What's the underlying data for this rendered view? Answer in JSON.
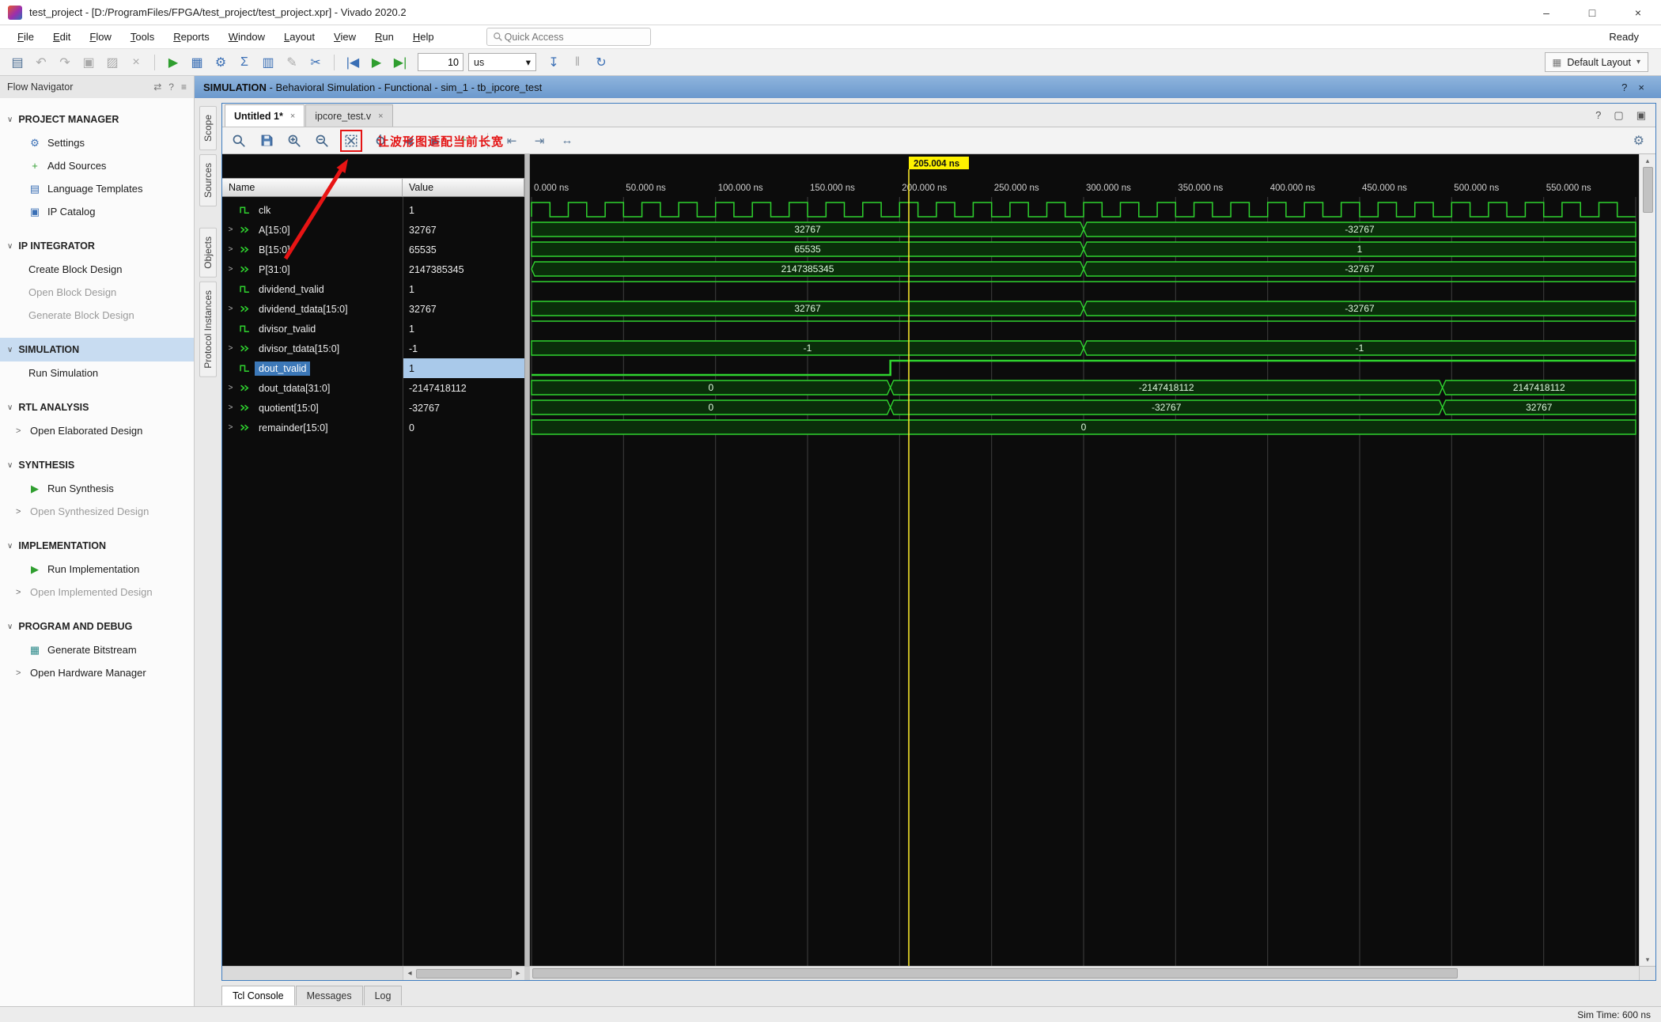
{
  "window": {
    "title": "test_project - [D:/ProgramFiles/FPGA/test_project/test_project.xpr] - Vivado 2020.2",
    "controls": [
      {
        "name": "minimize-button",
        "glyph": "–"
      },
      {
        "name": "maximize-button",
        "glyph": "□"
      },
      {
        "name": "close-button",
        "glyph": "×"
      }
    ]
  },
  "icons": {
    "dropdown": "▾",
    "help": "?",
    "close": "×",
    "chevron_down": "∨",
    "chevron_right": ">",
    "scroll_left": "◂",
    "scroll_right": "▸",
    "scroll_up": "▴",
    "scroll_down": "▾",
    "gear": "⚙"
  },
  "menu": {
    "items": [
      "File",
      "Edit",
      "Flow",
      "Tools",
      "Reports",
      "Window",
      "Layout",
      "View",
      "Run",
      "Help"
    ],
    "quick_access_placeholder": "Quick Access",
    "ready_label": "Ready"
  },
  "toolbar": {
    "items": [
      {
        "t": "icon",
        "name": "save-file-icon",
        "glyph": "▤"
      },
      {
        "t": "icon",
        "name": "undo-icon",
        "glyph": "↶",
        "dim": true
      },
      {
        "t": "icon",
        "name": "redo-icon",
        "glyph": "↷",
        "dim": true
      },
      {
        "t": "icon",
        "name": "copy-icon",
        "glyph": "▣",
        "dim": true
      },
      {
        "t": "icon",
        "name": "paste-icon",
        "glyph": "▨",
        "dim": true
      },
      {
        "t": "icon",
        "name": "delete-icon",
        "glyph": "×",
        "dim": true
      },
      {
        "t": "sep"
      },
      {
        "t": "icon",
        "name": "run-flow-icon",
        "glyph": "▶",
        "color": "green"
      },
      {
        "t": "icon",
        "name": "flow-dashboard-icon",
        "glyph": "▦",
        "color": "blue"
      },
      {
        "t": "icon",
        "name": "settings-gear-icon",
        "glyph": "⚙",
        "color": "blue"
      },
      {
        "t": "icon",
        "name": "report-sigma-icon",
        "glyph": "Σ",
        "color": "blue"
      },
      {
        "t": "icon",
        "name": "report-table-icon",
        "glyph": "▥",
        "color": "blue"
      },
      {
        "t": "icon",
        "name": "edit-pencil-icon",
        "glyph": "✎",
        "dim": true
      },
      {
        "t": "icon",
        "name": "set-probes-icon",
        "glyph": "✂",
        "color": "blue"
      },
      {
        "t": "sep"
      },
      {
        "t": "icon",
        "name": "restart-simulation-icon",
        "glyph": "|◀",
        "color": "blue"
      },
      {
        "t": "icon",
        "name": "run-all-icon",
        "glyph": "▶",
        "color": "green"
      },
      {
        "t": "icon",
        "name": "step-icon",
        "glyph": "▶|",
        "color": "green"
      },
      {
        "t": "time"
      },
      {
        "t": "unit"
      },
      {
        "t": "icon",
        "name": "run-for-time-icon",
        "glyph": "↧",
        "color": "blue"
      },
      {
        "t": "icon",
        "name": "pause-icon",
        "glyph": "‖",
        "dim": true
      },
      {
        "t": "icon",
        "name": "relaunch-simulation-icon",
        "glyph": "↻",
        "color": "blue"
      }
    ],
    "time_value": "10",
    "time_unit": "us",
    "layout_label": "Default Layout"
  },
  "context_bar": {
    "strong": "SIMULATION",
    "rest": " - Behavioral Simulation - Functional - sim_1 - tb_ipcore_test",
    "icons": [
      {
        "name": "help-icon",
        "glyph": "?"
      },
      {
        "name": "close-icon",
        "glyph": "×"
      }
    ]
  },
  "flow_navigator": {
    "title": "Flow Navigator",
    "header_icons": [
      {
        "name": "toggle-layout-icon",
        "glyph": "⇄"
      },
      {
        "name": "help-icon",
        "glyph": "?"
      },
      {
        "name": "collapse-all-icon",
        "glyph": "≡"
      }
    ],
    "sections": [
      {
        "label": "PROJECT MANAGER",
        "items": [
          {
            "label": "Settings",
            "icon": {
              "name": "settings-gear-icon",
              "glyph": "⚙",
              "color": "blue"
            }
          },
          {
            "label": "Add Sources",
            "icon": {
              "name": "add-sources-icon",
              "glyph": "+",
              "color": "green"
            }
          },
          {
            "label": "Language Templates",
            "icon": {
              "name": "language-templates-icon",
              "glyph": "▤",
              "color": "blue"
            }
          },
          {
            "label": "IP Catalog",
            "icon": {
              "name": "ip-catalog-icon",
              "glyph": "▣",
              "color": "blue"
            }
          }
        ]
      },
      {
        "label": "IP INTEGRATOR",
        "items": [
          {
            "label": "Create Block Design"
          },
          {
            "label": "Open Block Design",
            "disabled": true
          },
          {
            "label": "Generate Block Design",
            "disabled": true
          }
        ]
      },
      {
        "label": "SIMULATION",
        "selected": true,
        "items": [
          {
            "label": "Run Simulation"
          }
        ]
      },
      {
        "label": "RTL ANALYSIS",
        "items": [
          {
            "label": "Open Elaborated Design",
            "expander": true
          }
        ]
      },
      {
        "label": "SYNTHESIS",
        "items": [
          {
            "label": "Run Synthesis",
            "icon": {
              "name": "run-synthesis-icon",
              "glyph": "▶",
              "color": "green"
            }
          },
          {
            "label": "Open Synthesized Design",
            "expander": true,
            "disabled": true
          }
        ]
      },
      {
        "label": "IMPLEMENTATION",
        "items": [
          {
            "label": "Run Implementation",
            "icon": {
              "name": "run-implementation-icon",
              "glyph": "▶",
              "color": "green"
            }
          },
          {
            "label": "Open Implemented Design",
            "expander": true,
            "disabled": true
          }
        ]
      },
      {
        "label": "PROGRAM AND DEBUG",
        "items": [
          {
            "label": "Generate Bitstream",
            "icon": {
              "name": "generate-bitstream-icon",
              "glyph": "▦",
              "color": "teal"
            }
          },
          {
            "label": "Open Hardware Manager",
            "expander": true
          }
        ]
      }
    ]
  },
  "editor": {
    "tabs": [
      {
        "label": "Untitled 1*",
        "active": true
      },
      {
        "label": "ipcore_test.v",
        "active": false
      }
    ],
    "tabbar_icons": [
      {
        "name": "help-icon",
        "glyph": "?"
      },
      {
        "name": "float-window-icon",
        "glyph": "▢"
      },
      {
        "name": "maximize-panel-icon",
        "glyph": "▣"
      }
    ],
    "side_tab_groups": [
      [
        "Scope",
        "Sources"
      ],
      [
        "Objects",
        "Protocol Instances"
      ]
    ],
    "annotation_text": "让波形图适配当前长宽"
  },
  "wave_toolbar": {
    "items": [
      {
        "t": "svg",
        "svg": "search",
        "name": "search-icon"
      },
      {
        "t": "svg",
        "svg": "save",
        "name": "save-waveform-icon"
      },
      {
        "t": "svg",
        "svg": "zoom-in",
        "name": "zoom-in-icon"
      },
      {
        "t": "svg",
        "svg": "zoom-out",
        "name": "zoom-out-icon"
      },
      {
        "t": "svg",
        "svg": "zoom-fit",
        "name": "zoom-fit-button",
        "boxed": true
      },
      {
        "t": "svg",
        "svg": "zoom-cursor",
        "name": "zoom-to-cursor-icon"
      },
      {
        "t": "glyph",
        "glyph": "◀",
        "name": "previous-transition-icon"
      },
      {
        "t": "glyph",
        "glyph": "▶",
        "name": "next-transition-icon"
      },
      {
        "t": "glyph",
        "glyph": "+",
        "name": "add-marker-icon",
        "color": "green"
      },
      {
        "t": "sep"
      },
      {
        "t": "glyph",
        "glyph": "⇤",
        "name": "go-to-start-icon"
      },
      {
        "t": "glyph",
        "glyph": "⇥",
        "name": "go-to-end-icon"
      },
      {
        "t": "glyph",
        "glyph": "↔",
        "name": "swap-cursors-icon"
      }
    ]
  },
  "wave": {
    "name_header": "Name",
    "value_header": "Value",
    "cursor_time_ns": 205.004,
    "cursor_label": "205.004 ns",
    "time_start_ns": 0,
    "time_end_ns": 600,
    "tick_interval_ns": 50,
    "tick_labels": [
      "0.000 ns",
      "50.000 ns",
      "100.000 ns",
      "150.000 ns",
      "200.000 ns",
      "250.000 ns",
      "300.000 ns",
      "350.000 ns",
      "400.000 ns",
      "450.000 ns",
      "500.000 ns",
      "550.000 ns"
    ],
    "signals": [
      {
        "name": "clk",
        "value": "1",
        "kind": "clock",
        "period_ns": 20
      },
      {
        "name": "A[15:0]",
        "value": "32767",
        "kind": "bus",
        "segments": [
          {
            "from": 0,
            "to": 300,
            "label": "32767"
          },
          {
            "from": 300,
            "to": 600,
            "label": "-32767"
          }
        ]
      },
      {
        "name": "B[15:0]",
        "value": "65535",
        "kind": "bus",
        "segments": [
          {
            "from": 0,
            "to": 300,
            "label": "65535"
          },
          {
            "from": 300,
            "to": 600,
            "label": "1"
          }
        ]
      },
      {
        "name": "P[31:0]",
        "value": "2147385345",
        "kind": "bus",
        "x_at_start": true,
        "segments": [
          {
            "from": 0,
            "to": 300,
            "label": "2147385345"
          },
          {
            "from": 300,
            "to": 600,
            "label": "-32767"
          }
        ]
      },
      {
        "name": "dividend_tvalid",
        "value": "1",
        "kind": "bit",
        "segments": [
          {
            "from": 0,
            "to": 600,
            "level": 1
          }
        ]
      },
      {
        "name": "dividend_tdata[15:0]",
        "value": "32767",
        "kind": "bus",
        "segments": [
          {
            "from": 0,
            "to": 300,
            "label": "32767"
          },
          {
            "from": 300,
            "to": 600,
            "label": "-32767"
          }
        ]
      },
      {
        "name": "divisor_tvalid",
        "value": "1",
        "kind": "bit",
        "segments": [
          {
            "from": 0,
            "to": 600,
            "level": 1
          }
        ]
      },
      {
        "name": "divisor_tdata[15:0]",
        "value": "-1",
        "kind": "bus",
        "segments": [
          {
            "from": 0,
            "to": 300,
            "label": "-1"
          },
          {
            "from": 300,
            "to": 600,
            "label": "-1"
          }
        ]
      },
      {
        "name": "dout_tvalid",
        "value": "1",
        "kind": "bit",
        "selected": true,
        "segments": [
          {
            "from": 0,
            "to": 195,
            "level": 0
          },
          {
            "from": 195,
            "to": 600,
            "level": 1
          }
        ]
      },
      {
        "name": "dout_tdata[31:0]",
        "value": "-2147418112",
        "kind": "bus",
        "segments": [
          {
            "from": 0,
            "to": 195,
            "label": "0"
          },
          {
            "from": 195,
            "to": 495,
            "label": "-2147418112"
          },
          {
            "from": 495,
            "to": 600,
            "label": "2147418112"
          }
        ]
      },
      {
        "name": "quotient[15:0]",
        "value": "-32767",
        "kind": "bus",
        "segments": [
          {
            "from": 0,
            "to": 195,
            "label": "0"
          },
          {
            "from": 195,
            "to": 495,
            "label": "-32767"
          },
          {
            "from": 495,
            "to": 600,
            "label": "32767"
          }
        ]
      },
      {
        "name": "remainder[15:0]",
        "value": "0",
        "kind": "bus",
        "segments": [
          {
            "from": 0,
            "to": 600,
            "label": "0"
          }
        ]
      }
    ]
  },
  "bottom_tabs": [
    {
      "label": "Tcl Console",
      "active": true
    },
    {
      "label": "Messages",
      "active": false
    },
    {
      "label": "Log",
      "active": false
    }
  ],
  "status_bar": {
    "sim_time": "Sim Time: 600 ns"
  },
  "colors": {
    "wave_green": "#2fd32f",
    "bus_fill": "#0a2e0a",
    "cursor_yellow": "#f3e32a",
    "cursor_label_bg": "#fef200",
    "selection_blue": "#3c78b8",
    "annotation_red": "#e41414"
  }
}
